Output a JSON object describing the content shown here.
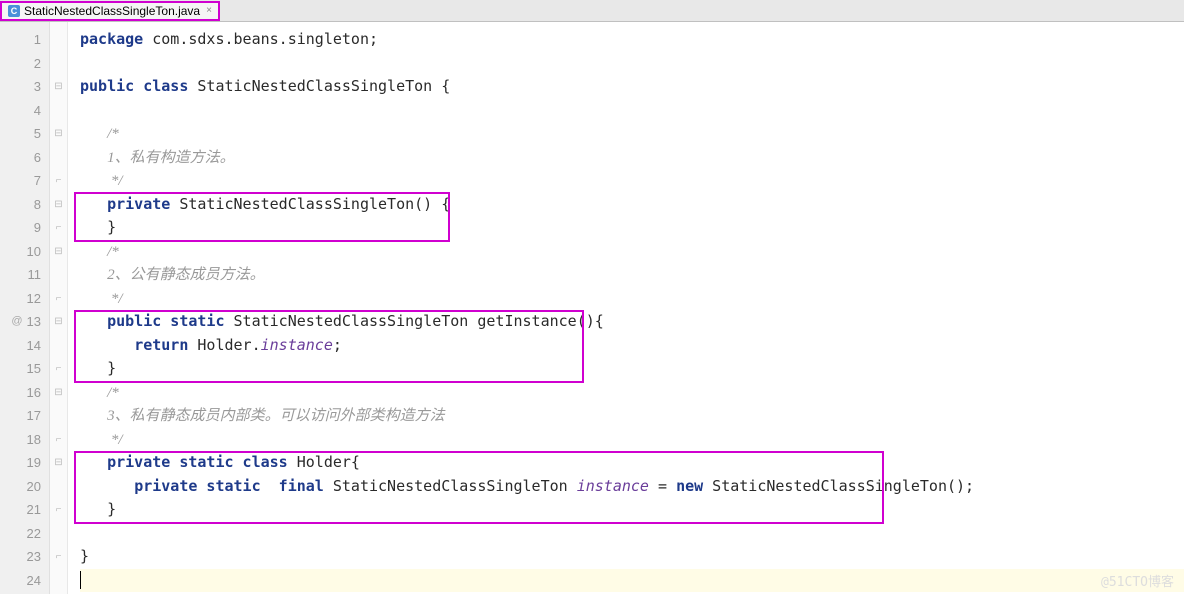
{
  "tab": {
    "icon_letter": "C",
    "filename": "StaticNestedClassSingleTon.java",
    "close_glyph": "×"
  },
  "gutter": {
    "lines": [
      "1",
      "2",
      "3",
      "4",
      "5",
      "6",
      "7",
      "8",
      "9",
      "10",
      "11",
      "12",
      "13",
      "14",
      "15",
      "16",
      "17",
      "18",
      "19",
      "20",
      "21",
      "22",
      "23",
      "24"
    ],
    "override_marker": "@"
  },
  "code": {
    "l1_kw": "package",
    "l1_rest": " com.sdxs.beans.singleton;",
    "l3_kw": "public class",
    "l3_rest": " StaticNestedClassSingleTon {",
    "l5_c": "/*",
    "l6_c": "1、私有构造方法。",
    "l7_c": " */",
    "l8_kw": "private",
    "l8_rest": " StaticNestedClassSingleTon() {",
    "l9_rest": "}",
    "l10_c": "/*",
    "l11_c": "2、公有静态成员方法。",
    "l12_c": " */",
    "l13_kw": "public static",
    "l13_rest": " StaticNestedClassSingleTon getInstance(){",
    "l14_kw": "return",
    "l14_mid": " Holder.",
    "l14_field": "instance",
    "l14_end": ";",
    "l15_rest": "}",
    "l16_c": "/*",
    "l17_c": "3、私有静态成员内部类。可以访问外部类构造方法",
    "l18_c": " */",
    "l19_kw": "private static class",
    "l19_rest": " Holder{",
    "l20_kw1": "private static  final",
    "l20_mid1": " StaticNestedClassSingleTon ",
    "l20_field": "instance",
    "l20_mid2": " = ",
    "l20_kw2": "new",
    "l20_rest": " StaticNestedClassSingleTon();",
    "l21_rest": "}",
    "l23_rest": "}"
  },
  "watermark": "@51CTO博客"
}
